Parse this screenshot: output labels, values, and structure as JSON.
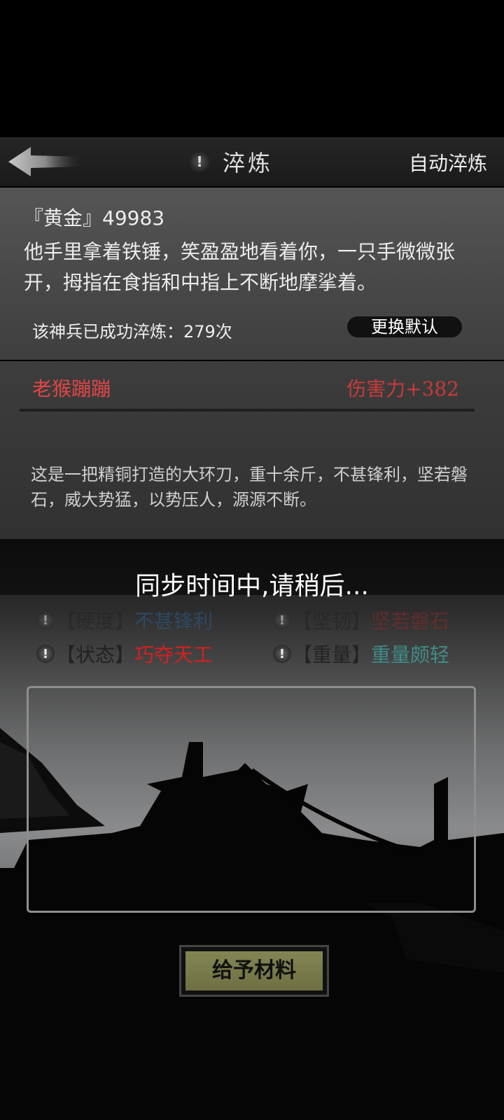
{
  "header": {
    "title": "淬炼",
    "auto_label": "自动淬炼"
  },
  "npc": {
    "gold_label": "『黄金』",
    "gold_value": "49983",
    "dialogue": "他手里拿着铁锤，笑盈盈地看着你，一只手微微张开，拇指在食指和中指上不断地摩挲着。",
    "refine_count_text": "该神兵已成功淬炼：279次",
    "default_button": "更换默认"
  },
  "weapon": {
    "name": "老猴蹦蹦",
    "damage": "伤害力+382",
    "description": "这是一把精铜打造的大环刀，重十余斤，不甚锋利，坚若磐石，威大势猛，以势压人，源源不断。"
  },
  "overlay": {
    "sync_text": "同步时间中,请稍后..."
  },
  "attributes": [
    {
      "key": "【硬度】",
      "value": "不甚锋利",
      "color": "#2d5c8a"
    },
    {
      "key": "【坚韧】",
      "value": "坚若磐石",
      "color": "#8a2a2a"
    },
    {
      "key": "【状态】",
      "value": "巧夺天工",
      "color": "#d62020"
    },
    {
      "key": "【重量】",
      "value": "重量颇轻",
      "color": "#3f8c86"
    }
  ],
  "actions": {
    "give_material": "给予材料"
  }
}
